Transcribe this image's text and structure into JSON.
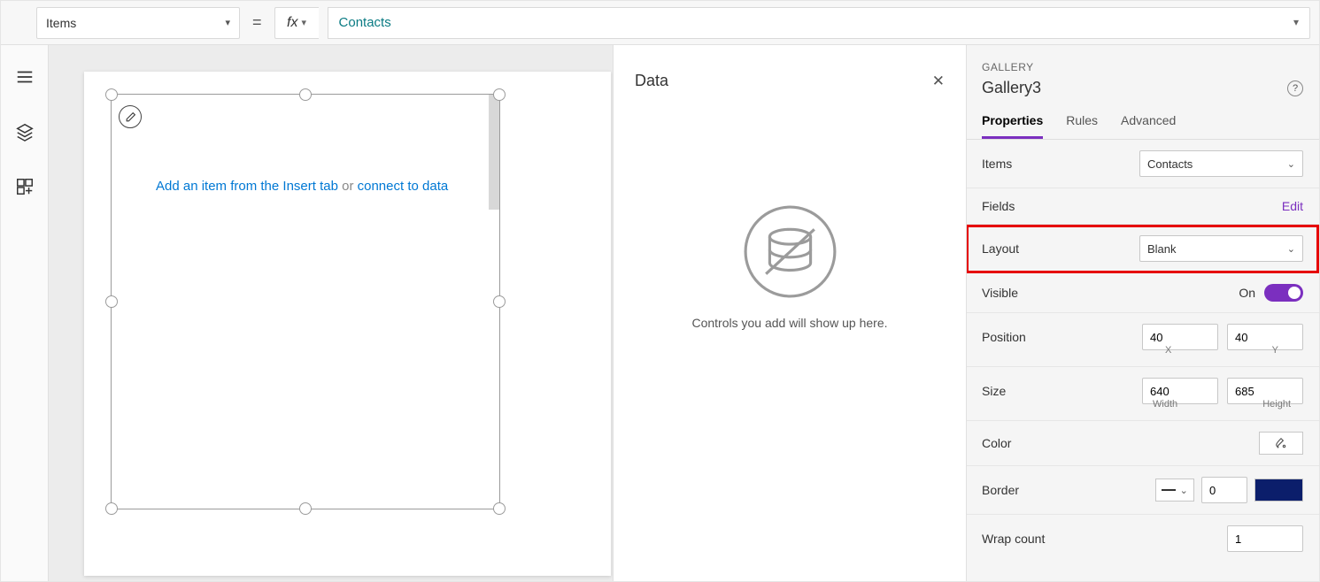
{
  "formula_bar": {
    "property": "Items",
    "formula": "Contacts"
  },
  "canvas": {
    "hint_prefix": "Add an item from the Insert tab",
    "hint_or": "or ",
    "hint_link": "connect to data"
  },
  "data_pane": {
    "title": "Data",
    "empty_text": "Controls you add will show up here."
  },
  "props": {
    "type_label": "GALLERY",
    "control_name": "Gallery3",
    "tabs": {
      "properties": "Properties",
      "rules": "Rules",
      "advanced": "Advanced"
    },
    "items_label": "Items",
    "items_value": "Contacts",
    "fields_label": "Fields",
    "fields_link": "Edit",
    "layout_label": "Layout",
    "layout_value": "Blank",
    "visible_label": "Visible",
    "visible_state": "On",
    "position_label": "Position",
    "position_x": "40",
    "position_y": "40",
    "pos_xlabel": "X",
    "pos_ylabel": "Y",
    "size_label": "Size",
    "size_w": "640",
    "size_h": "685",
    "size_wlabel": "Width",
    "size_hlabel": "Height",
    "color_label": "Color",
    "border_label": "Border",
    "border_width": "0",
    "wrap_label": "Wrap count",
    "wrap_value": "1"
  }
}
